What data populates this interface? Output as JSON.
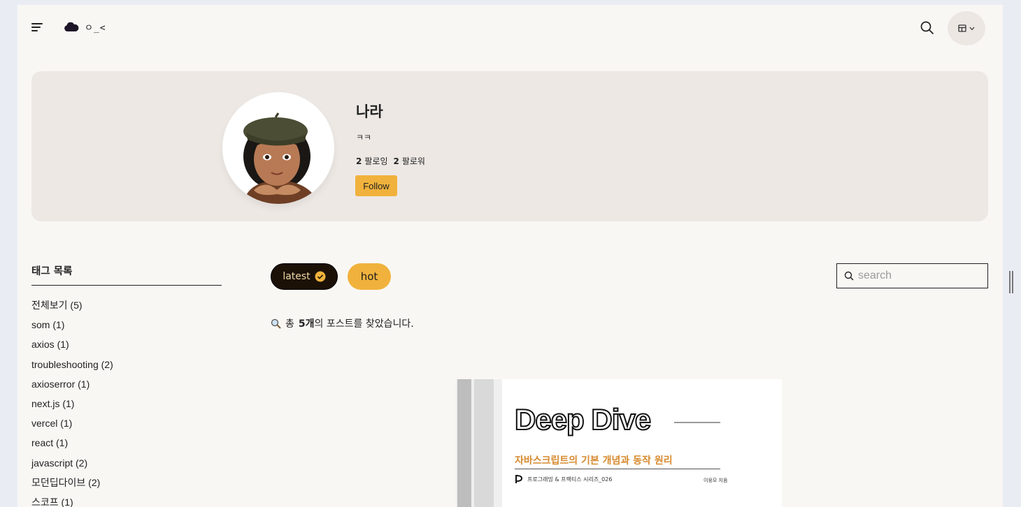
{
  "header": {
    "logo_text": "ㅇ_<",
    "menu_icon": "hamburger-icon",
    "search_icon": "search-icon",
    "theme_icon": "layout-icon"
  },
  "profile": {
    "name": "나라",
    "bio": "ㅋㅋ",
    "following_count": "2",
    "following_label": "팔로잉",
    "followers_count": "2",
    "followers_label": "팔로워",
    "follow_button": "Follow"
  },
  "sidebar": {
    "title": "태그 목록",
    "tags": [
      "전체보기 (5)",
      "som (1)",
      "axios (1)",
      "troubleshooting (2)",
      "axioserror (1)",
      "next.js (1)",
      "vercel (1)",
      "react (1)",
      "javascript (2)",
      "모던딥다이브 (2)",
      "스코프 (1)"
    ]
  },
  "tabs": {
    "latest": "latest",
    "hot": "hot"
  },
  "search": {
    "placeholder": "search"
  },
  "result": {
    "prefix": "총",
    "count": "5개",
    "suffix": "의 포스트를 찾았습니다."
  },
  "post": {
    "book_title": "Deep Dive",
    "book_subtitle": "자바스크립트의 기본 개념과 동작 원리",
    "publisher": "프로그래밍 & 프랙티스 시리즈_026",
    "author": "이웅모 지음"
  },
  "colors": {
    "accent": "#f0b23c",
    "card_bg": "#ede8e4",
    "page_bg": "#f9f7f4",
    "dark_tab": "#1b1107"
  }
}
